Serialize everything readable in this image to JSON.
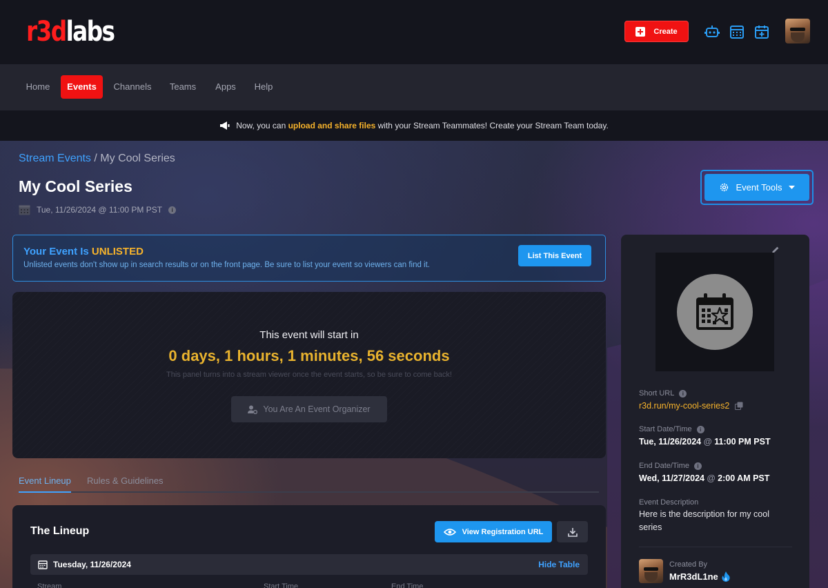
{
  "header": {
    "logo_red": "r3d",
    "logo_white": "labs",
    "create_label": "Create"
  },
  "nav": {
    "items": [
      {
        "label": "Home",
        "active": false
      },
      {
        "label": "Events",
        "active": true
      },
      {
        "label": "Channels",
        "active": false
      },
      {
        "label": "Teams",
        "active": false
      },
      {
        "label": "Apps",
        "active": false
      },
      {
        "label": "Help",
        "active": false
      }
    ]
  },
  "announcement": {
    "prefix": "Now, you can",
    "highlight": "upload and share files",
    "suffix": "with your Stream Teammates! Create your Stream Team today."
  },
  "breadcrumb": {
    "link": "Stream Events",
    "separator": "/",
    "current": "My Cool Series"
  },
  "page": {
    "title": "My Cool Series",
    "date": "Tue, 11/26/2024 @ 11:00 PM PST"
  },
  "event_tools": {
    "label": "Event Tools"
  },
  "unlisted": {
    "title_prefix": "Your Event Is",
    "title_status": "UNLISTED",
    "description": "Unlisted events don't show up in search results or on the front page. Be sure to list your event so viewers can find it.",
    "button_label": "List This Event"
  },
  "countdown": {
    "label": "This event will start in",
    "value": "0 days, 1 hours, 1 minutes, 56 seconds",
    "note": "This panel turns into a stream viewer once the event starts, so be sure to come back!",
    "organizer_label": "You Are An Event Organizer"
  },
  "tabs": [
    {
      "label": "Event Lineup",
      "active": true
    },
    {
      "label": "Rules & Guidelines",
      "active": false
    }
  ],
  "lineup": {
    "title": "The Lineup",
    "view_registration_label": "View Registration URL",
    "day_label": "Tuesday, 11/26/2024",
    "hide_table_label": "Hide Table",
    "columns": [
      "Stream",
      "Start Time",
      "End Time"
    ]
  },
  "sidebar": {
    "short_url_label": "Short URL",
    "short_url": "r3d.run/my-cool-series2",
    "start_label": "Start Date/Time",
    "start_date": "Tue, 11/26/2024",
    "start_time": "11:00 PM PST",
    "end_label": "End Date/Time",
    "end_date": "Wed, 11/27/2024",
    "end_time": "2:00 AM PST",
    "at": "@",
    "description_label": "Event Description",
    "description": "Here is the description for my cool series",
    "created_by_label": "Created By",
    "creator_name": "MrR3dL1ne"
  },
  "colors": {
    "brand_red": "#f01212",
    "accent_blue": "#1e96ef",
    "highlight_yellow": "#f7b32b"
  }
}
